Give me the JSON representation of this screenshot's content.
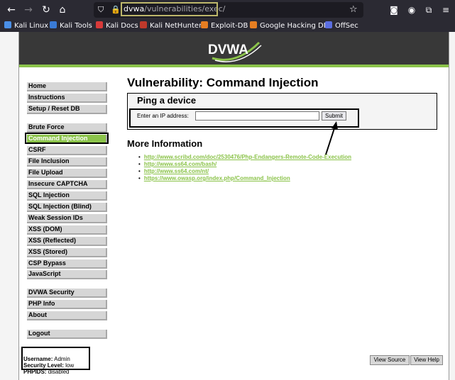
{
  "browser": {
    "url_host": "dvwa",
    "url_path": "/vulnerabilities/exec/",
    "bookmarks": [
      "Kali Linux",
      "Kali Tools",
      "Kali Docs",
      "Kali NetHunter",
      "Exploit-DB",
      "Google Hacking DB",
      "OffSec"
    ]
  },
  "header": {
    "logo_text": "DVWA"
  },
  "sidebar": {
    "group1": [
      "Home",
      "Instructions",
      "Setup / Reset DB"
    ],
    "group2": [
      "Brute Force",
      "Command Injection",
      "CSRF",
      "File Inclusion",
      "File Upload",
      "Insecure CAPTCHA",
      "SQL Injection",
      "SQL Injection (Blind)",
      "Weak Session IDs",
      "XSS (DOM)",
      "XSS (Reflected)",
      "XSS (Stored)",
      "CSP Bypass",
      "JavaScript"
    ],
    "group3": [
      "DVWA Security",
      "PHP Info",
      "About"
    ],
    "group4": [
      "Logout"
    ],
    "active": "Command Injection"
  },
  "main": {
    "title": "Vulnerability: Command Injection",
    "ping_title": "Ping a device",
    "ip_label": "Enter an IP address:",
    "ip_value": "",
    "submit_label": "Submit",
    "more_info_title": "More Information",
    "links": [
      "http://www.scribd.com/doc/2530476/Php-Endangers-Remote-Code-Execution",
      "http://www.ss64.com/bash/",
      "http://www.ss64.com/nt/",
      "https://www.owasp.org/index.php/Command_Injection"
    ]
  },
  "footer": {
    "username_label": "Username:",
    "username_value": "Admin",
    "security_label": "Security Level:",
    "security_value": "low",
    "phpids_label": "PHPIDS:",
    "phpids_value": "disabled",
    "view_source": "View Source",
    "view_help": "View Help"
  },
  "colors": {
    "accent": "#8bc34a",
    "header_bg": "#383838",
    "chrome_bg": "#2b2a33"
  }
}
